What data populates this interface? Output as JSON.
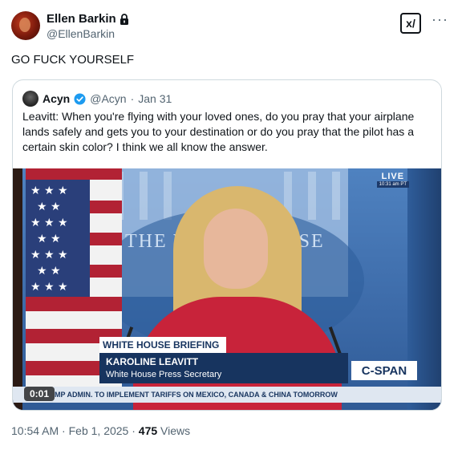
{
  "author": {
    "display_name": "Ellen Barkin",
    "handle": "@EllenBarkin"
  },
  "tweet": {
    "text": "GO FUCK YOURSELF",
    "time": "10:54 AM",
    "date": "Feb 1, 2025",
    "views_count": "475",
    "views_label": "Views"
  },
  "quoted": {
    "display_name": "Acyn",
    "handle": "@Acyn",
    "date": "Jan 31",
    "text": "Leavitt: When you're flying with your loved ones, do you pray that your airplane lands safely and gets you to your destination or do you pray that the pilot has a certain skin color? I think we all know the answer.",
    "video": {
      "live": "LIVE",
      "live_time": "10:31 am PT",
      "backdrop_left": "THE W",
      "backdrop_right": "OUSE",
      "chyron_title": "WHITE HOUSE BRIEFING",
      "chyron_name": "KAROLINE LEAVITT",
      "chyron_role": "White House Press Secretary",
      "network": "C-SPAN",
      "ticker": "MP ADMIN. TO IMPLEMENT TARIFFS ON MEXICO, CANADA & CHINA TOMORROW",
      "elapsed": "0:01"
    }
  },
  "icons": {
    "lock": "lock-icon",
    "verified": "verified-badge-icon",
    "grok": "grok-icon",
    "more": "more-icon"
  },
  "grok_label": "x/",
  "more_label": "···",
  "colors": {
    "text": "#0f1419",
    "secondary": "#536471",
    "verified": "#1d9bf0",
    "cspan_navy": "#17345f"
  }
}
